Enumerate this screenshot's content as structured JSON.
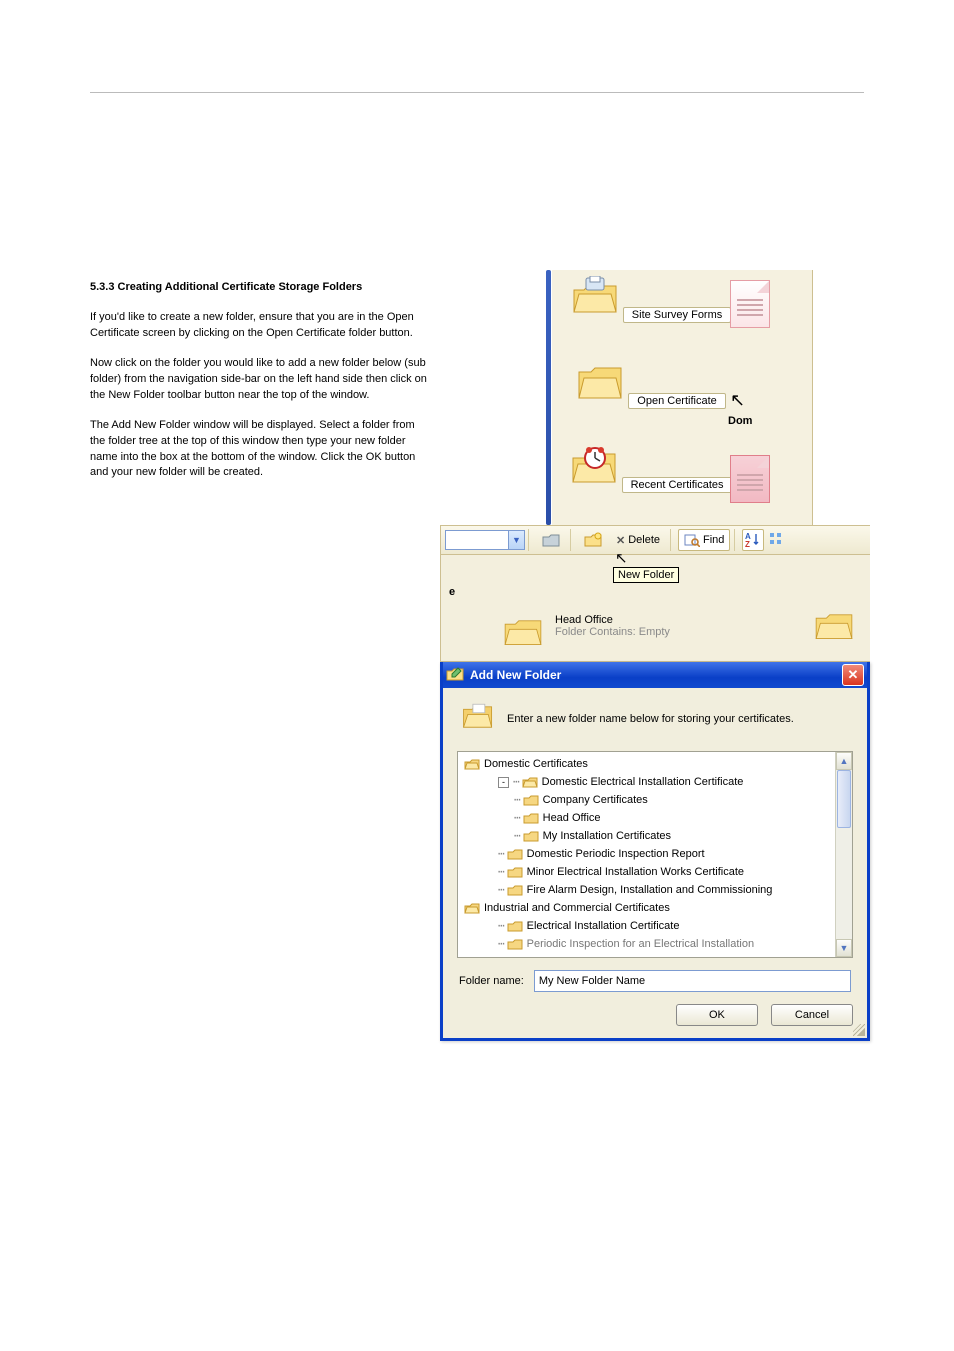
{
  "doc": {
    "heading": "5.3.3 Creating Additional Certificate Storage Folders",
    "paras": [
      "If you'd like to create a new folder, ensure that you are in the Open Certificate screen by clicking on the Open Certificate folder button.",
      "Now click on the folder you would like to add a new folder below (sub folder) from the navigation side-bar on the left hand side then click on the New Folder toolbar button near the top of the window.",
      "The Add New Folder window will be displayed. Select a folder from the folder tree at the top of this window then type your new folder name into the box at the bottom of the window. Click the OK button and your new folder will be created."
    ]
  },
  "panel1": {
    "items": [
      "Site Survey Forms",
      "Open Certificate",
      "Recent Certificates"
    ],
    "sideLabel": "Dom"
  },
  "panel2": {
    "delete": "Delete",
    "find": "Find",
    "tooltip": "New Folder",
    "rowE": "e",
    "folderTitle": "Head Office",
    "folderSub": "Folder Contains: Empty"
  },
  "dlg": {
    "title": "Add New Folder",
    "hint": "Enter a new folder name below for storing your certificates.",
    "tree": [
      {
        "lvl": 0,
        "kind": "open",
        "label": "Domestic Certificates"
      },
      {
        "lvl": 1,
        "kind": "open",
        "label": "Domestic Electrical Installation Certificate",
        "box": "-"
      },
      {
        "lvl": 2,
        "kind": "closed",
        "label": "Company Certificates"
      },
      {
        "lvl": 2,
        "kind": "closed",
        "label": "Head Office"
      },
      {
        "lvl": 2,
        "kind": "closed",
        "label": "My Installation Certificates"
      },
      {
        "lvl": 1,
        "kind": "closed",
        "label": "Domestic Periodic Inspection Report"
      },
      {
        "lvl": 1,
        "kind": "closed",
        "label": "Minor Electrical Installation Works Certificate"
      },
      {
        "lvl": 1,
        "kind": "closed",
        "label": "Fire Alarm Design, Installation and Commissioning"
      },
      {
        "lvl": 0,
        "kind": "open",
        "label": "Industrial and Commercial Certificates"
      },
      {
        "lvl": 1,
        "kind": "closed",
        "label": "Electrical Installation Certificate"
      },
      {
        "lvl": 1,
        "kind": "closed",
        "label": "Periodic Inspection for an Electrical Installation",
        "cut": true
      }
    ],
    "fieldLabel": "Folder name:",
    "fieldValue": "My New Folder Name",
    "ok": "OK",
    "cancel": "Cancel"
  }
}
